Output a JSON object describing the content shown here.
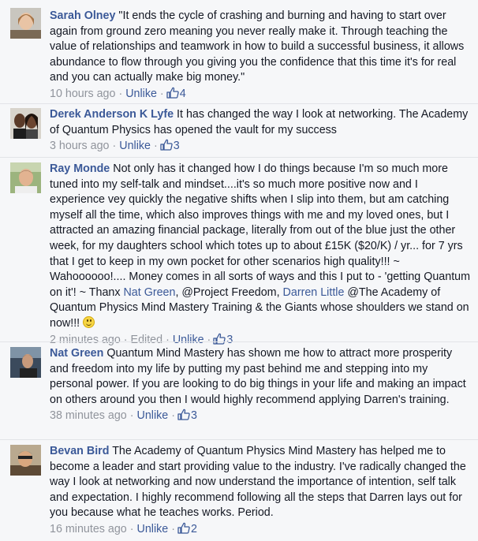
{
  "comments": [
    {
      "name": "Sarah Olney",
      "text": "\"It ends the cycle of crashing and burning and having to start over again from ground zero meaning you never really make it. Through teaching the value of relationships and teamwork in how to build a successful business, it allows abundance to flow through you giving you the confidence that this time it's for real and you can actually make big money.\"",
      "time": "10 hours ago",
      "unlike": "Unlike",
      "likes": "4"
    },
    {
      "name": "Derek Anderson K Lyfe",
      "text": "It has changed the way I look at networking. The Academy of Quantum Physics has opened the vault for my success",
      "time": "3 hours ago",
      "unlike": "Unlike",
      "likes": "3"
    },
    {
      "name": "Ray Monde",
      "text_a": "Not only has it changed how I do things because I'm so much more tuned into my self-talk and mindset....it's so much more positive now and I experience vey quickly the negative shifts when I slip into them, but am catching myself all the time, which also improves things with me and my loved ones, but I attracted an amazing financial package, literally from out of the blue just the other week, for my daughters school which totes up to about £15K ($20/K) / yr... for 7 yrs that I get to keep in my own pocket for other scenarios high quality!!! ~ Wahoooooo!.... Money comes in all sorts of ways and this I put to - 'getting Quantum on it'! ~ Thanx",
      "mention1": "Nat Green",
      "text_b": ", @Project Freedom,",
      "mention2": "Darren Little",
      "text_c": "@The Academy of Quantum Physics Mind Mastery Training & the Giants whose shoulders we stand on now!!!",
      "time": "2 minutes ago",
      "edited": "Edited",
      "unlike": "Unlike",
      "likes": "3"
    },
    {
      "name": "Nat Green",
      "text": "Quantum Mind Mastery has shown me how to attract more prosperity and freedom into my life by putting my past behind me and stepping into my personal power. If you are looking to do big things in your life and making an impact on others around you then I would highly recommend applying Darren's training.",
      "time": "38 minutes ago",
      "unlike": "Unlike",
      "likes": "3"
    },
    {
      "name": "Bevan Bird",
      "text": "The Academy of Quantum Physics Mind Mastery has helped me to become a leader and start providing value to the industry. I've radically changed the way I look at networking and now understand the importance of intention, self talk and expectation. I highly recommend following all the steps that Darren lays out for you because what he teaches works. Period.",
      "time": "16 minutes ago",
      "unlike": "Unlike",
      "likes": "2"
    }
  ],
  "separator": "·",
  "colors": {
    "link": "#3b5998",
    "meta": "#90949c",
    "text": "#141823",
    "background": "#f6f7f9"
  },
  "icons": {
    "like": "thumbs-up-icon",
    "emoji": "smiley-icon"
  }
}
